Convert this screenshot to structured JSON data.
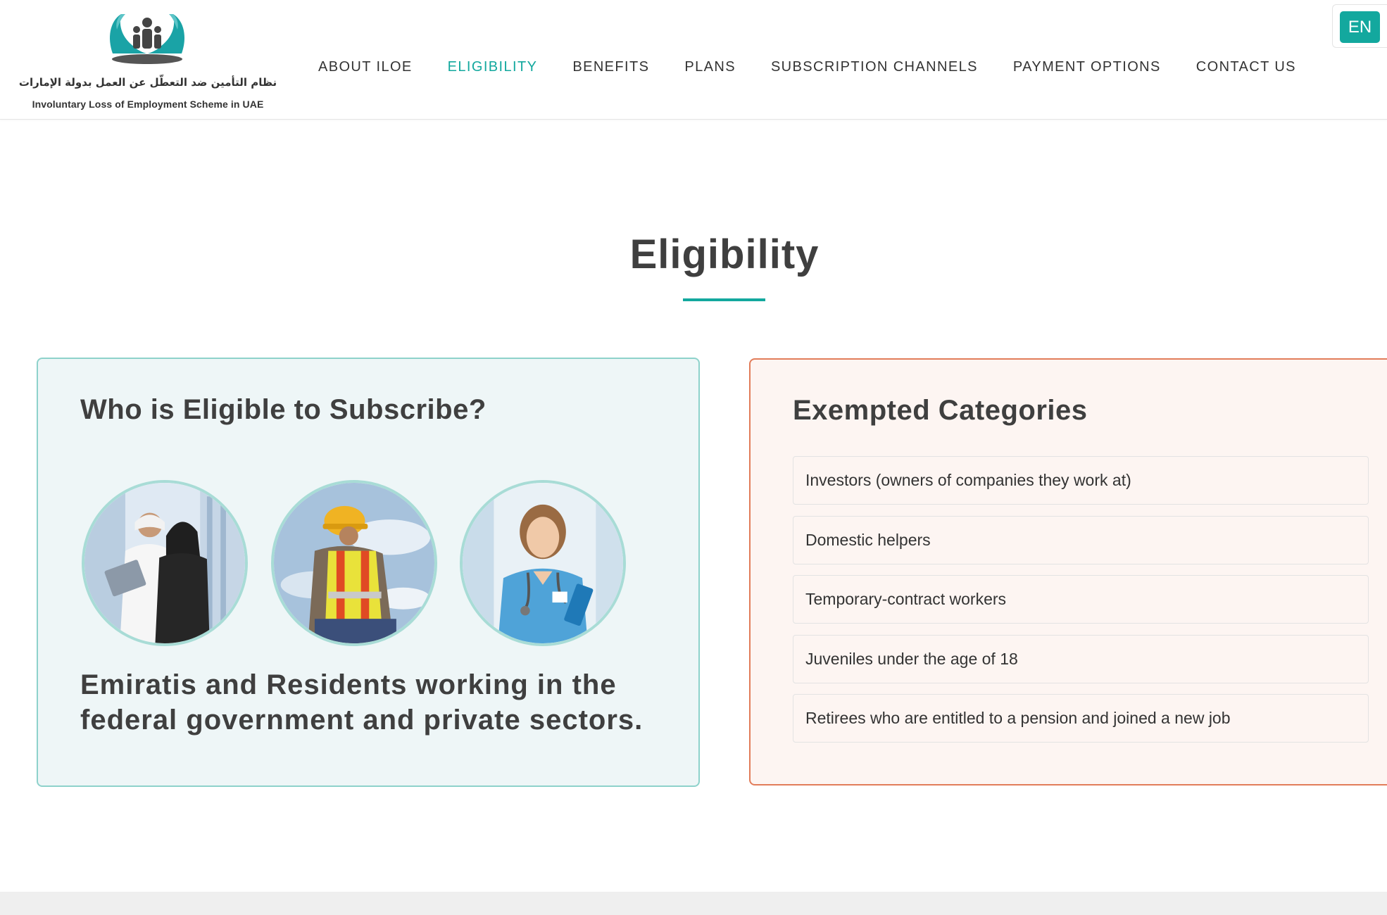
{
  "brand": {
    "name_ar": "نظام التأمين ضد التعطّل عن العمل بدولة الإمارات",
    "name_en": "Involuntary Loss of Employment Scheme in UAE",
    "accent_color": "#13a89e",
    "exempt_border_color": "#e27d5a"
  },
  "nav": {
    "items": [
      {
        "label": "ABOUT ILOE",
        "active": false
      },
      {
        "label": "ELIGIBILITY",
        "active": true
      },
      {
        "label": "BENEFITS",
        "active": false
      },
      {
        "label": "PLANS",
        "active": false
      },
      {
        "label": "SUBSCRIPTION CHANNELS",
        "active": false
      },
      {
        "label": "PAYMENT OPTIONS",
        "active": false
      },
      {
        "label": "CONTACT US",
        "active": false
      }
    ],
    "language_button": "EN"
  },
  "section": {
    "title": "Eligibility"
  },
  "eligible": {
    "heading": "Who is Eligible to Subscribe?",
    "images": [
      {
        "icon": "business-people-photo"
      },
      {
        "icon": "construction-worker-photo"
      },
      {
        "icon": "nurse-photo"
      }
    ],
    "description": "Emiratis and Residents working in the federal government and private sectors."
  },
  "exempted": {
    "heading": "Exempted Categories",
    "items": [
      "Investors (owners of companies they work at)",
      "Domestic helpers",
      "Temporary-contract workers",
      "Juveniles under the age of 18",
      "Retirees who are entitled to a pension and joined a new job"
    ]
  }
}
